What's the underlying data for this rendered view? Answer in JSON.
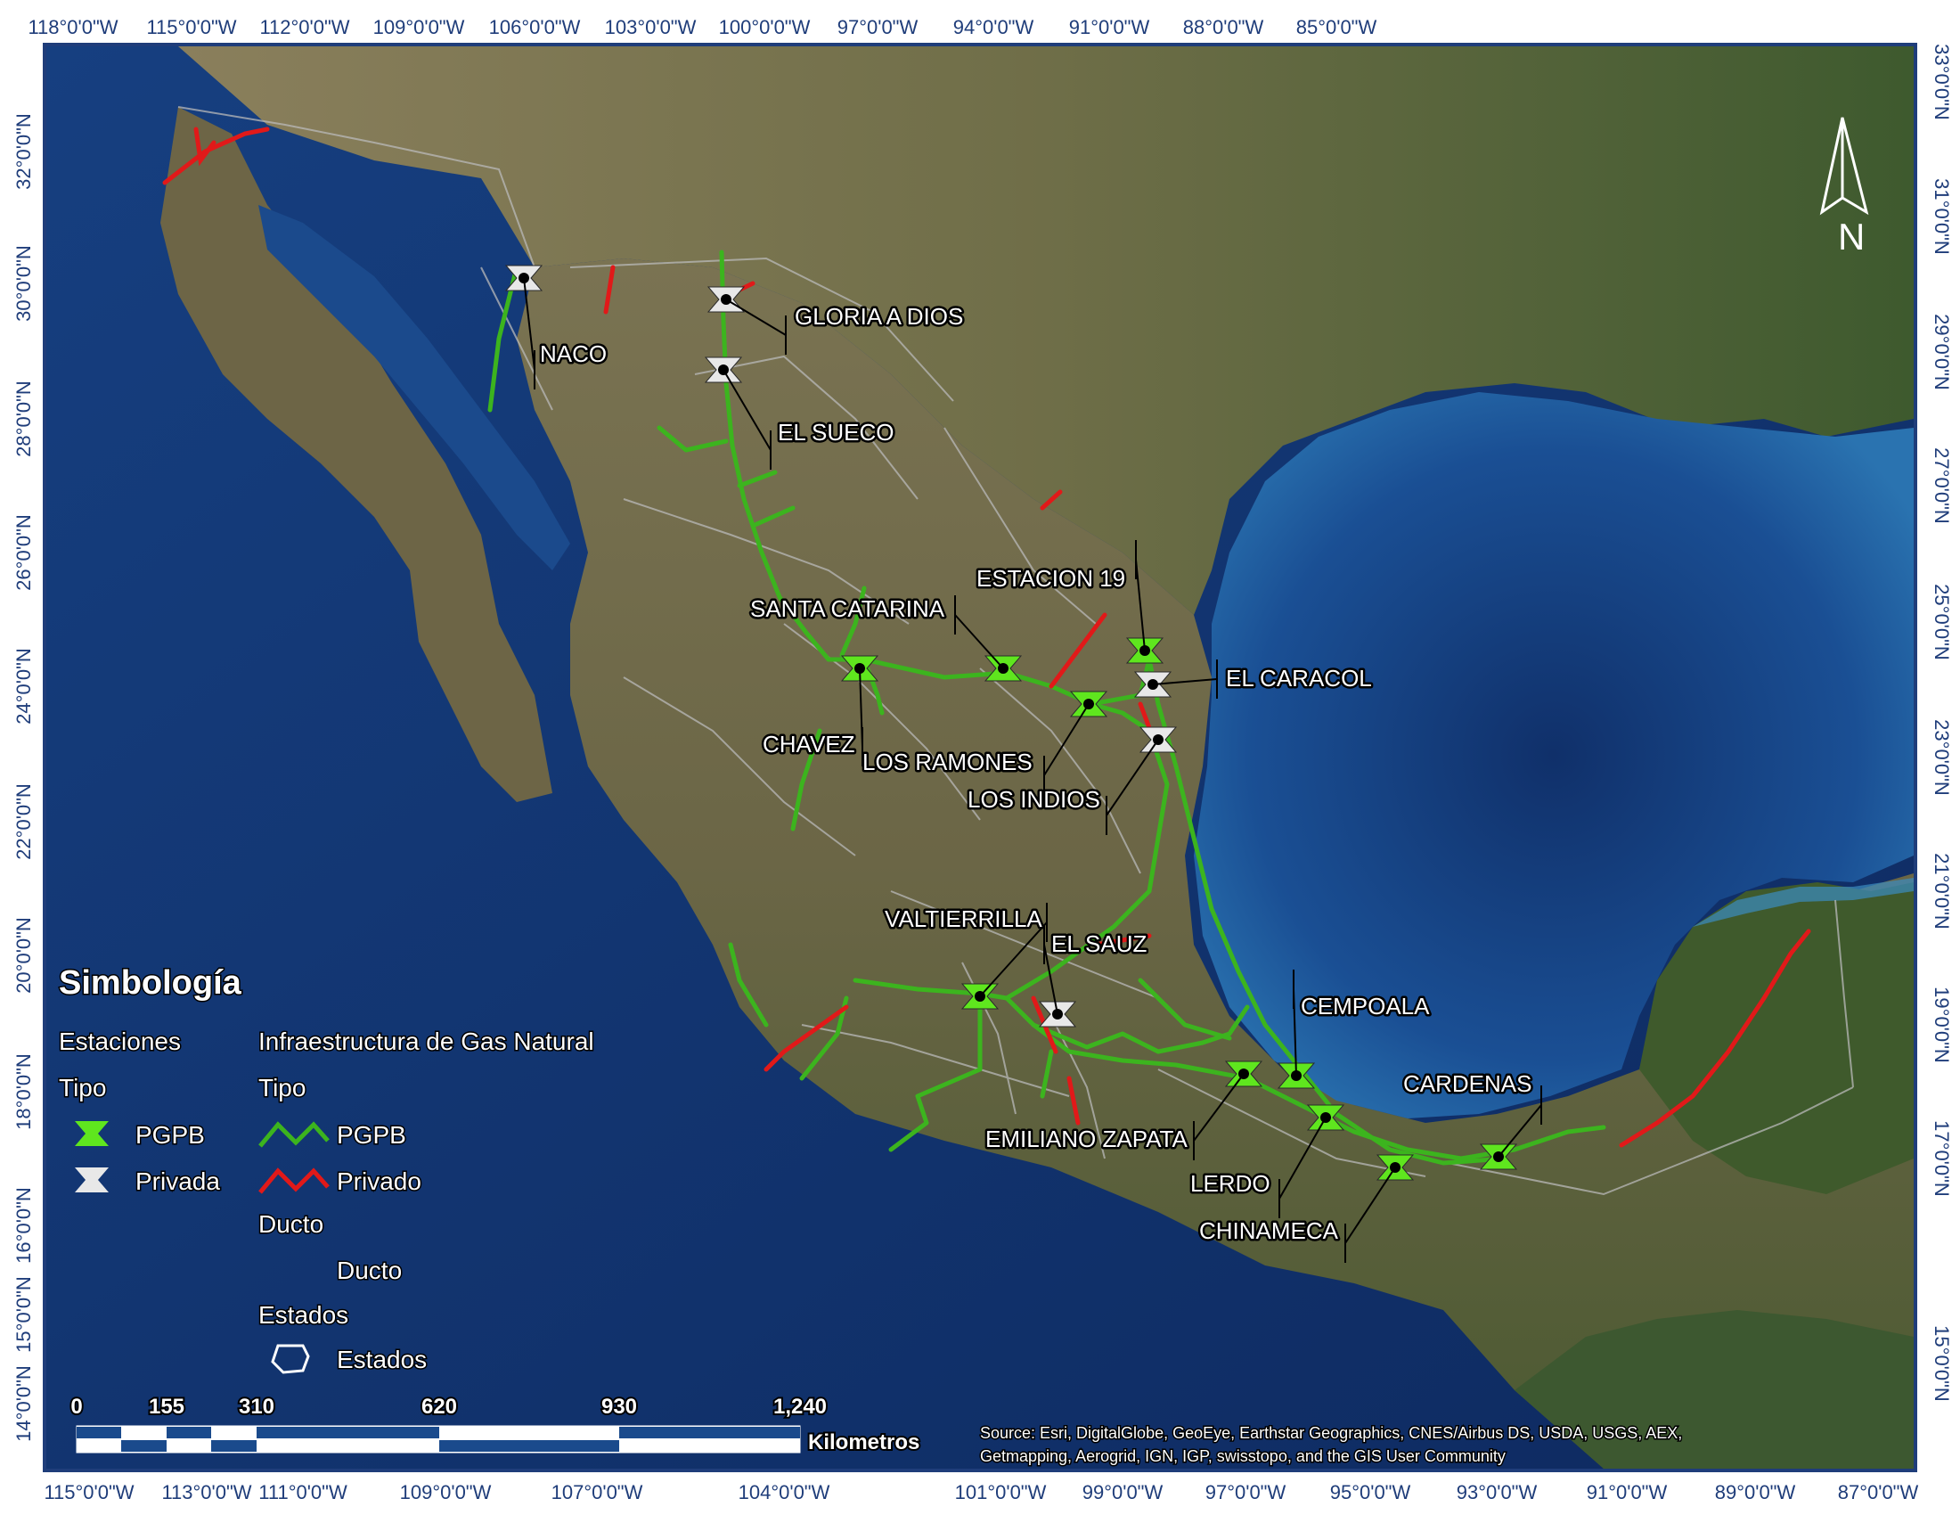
{
  "colors": {
    "ocean_deep": "#0f2d66",
    "ocean": "#1a4a8c",
    "land": "#6e6a4a",
    "land_green": "#3f5a2a",
    "pgpb": "#5fe61e",
    "pgpb_line": "#3cb41e",
    "privado": "#e11919",
    "privada_station": "#e8e8e8",
    "border": "#1f3d7a"
  },
  "axes": {
    "top_lon": [
      "118°0'0\"W",
      "115°0'0\"W",
      "112°0'0\"W",
      "109°0'0\"W",
      "106°0'0\"W",
      "103°0'0\"W",
      "100°0'0\"W",
      "97°0'0\"W",
      "94°0'0\"W",
      "91°0'0\"W",
      "88°0'0\"W",
      "85°0'0\"W"
    ],
    "bottom_lon": [
      "115°0'0\"W",
      "113°0'0\"W",
      "111°0'0\"W",
      "109°0'0\"W",
      "107°0'0\"W",
      "104°0'0\"W",
      "101°0'0\"W",
      "99°0'0\"W",
      "97°0'0\"W",
      "95°0'0\"W",
      "93°0'0\"W",
      "91°0'0\"W",
      "89°0'0\"W",
      "87°0'0\"W"
    ],
    "left_lat": [
      "32°0'0\"N",
      "30°0'0\"N",
      "28°0'0\"N",
      "26°0'0\"N",
      "24°0'0\"N",
      "22°0'0\"N",
      "20°0'0\"N",
      "18°0'0\"N",
      "16°0'0\"N",
      "15°0'0\"N",
      "14°0'0\"N"
    ],
    "right_lat": [
      "33°0'0\"N",
      "31°0'0\"N",
      "29°0'0\"N",
      "27°0'0\"N",
      "25°0'0\"N",
      "23°0'0\"N",
      "21°0'0\"N",
      "19°0'0\"N",
      "17°0'0\"N",
      "15°0'0\"N"
    ]
  },
  "stations": [
    {
      "name": "NACO",
      "type": "Privada"
    },
    {
      "name": "GLORIA A DIOS",
      "type": "Privada"
    },
    {
      "name": "EL SUECO",
      "type": "Privada"
    },
    {
      "name": "ESTACION 19",
      "type": "PGPB"
    },
    {
      "name": "SANTA CATARINA",
      "type": "PGPB"
    },
    {
      "name": "EL CARACOL",
      "type": "Privada"
    },
    {
      "name": "CHAVEZ",
      "type": "PGPB"
    },
    {
      "name": "LOS RAMONES",
      "type": "PGPB"
    },
    {
      "name": "LOS INDIOS",
      "type": "Privada"
    },
    {
      "name": "VALTIERRILLA",
      "type": "PGPB"
    },
    {
      "name": "EL SAUZ",
      "type": "Privada"
    },
    {
      "name": "CEMPOALA",
      "type": "PGPB"
    },
    {
      "name": "CARDENAS",
      "type": "PGPB"
    },
    {
      "name": "EMILIANO ZAPATA",
      "type": "PGPB"
    },
    {
      "name": "LERDO",
      "type": "PGPB"
    },
    {
      "name": "CHINAMECA",
      "type": "PGPB"
    }
  ],
  "legend": {
    "title": "Simbología",
    "stations_heading": "Estaciones",
    "stations_tipo": "Tipo",
    "stations_pgpb": "PGPB",
    "stations_privada": "Privada",
    "infra_heading": "Infraestructura de Gas Natural",
    "infra_tipo": "Tipo",
    "infra_pgpb": "PGPB",
    "infra_privado": "Privado",
    "ducto_heading": "Ducto",
    "ducto_item": "Ducto",
    "estados_heading": "Estados",
    "estados_item": "Estados"
  },
  "scale": {
    "ticks": [
      "0",
      "155",
      "310",
      "620",
      "930",
      "1,240"
    ],
    "unit": "Kilometros"
  },
  "north_label": "N",
  "source": {
    "line1": "Source: Esri, DigitalGlobe, GeoEye, Earthstar Geographics, CNES/Airbus DS, USDA, USGS, AEX,",
    "line2": "Getmapping, Aerogrid, IGN, IGP, swisstopo, and the GIS User Community"
  }
}
